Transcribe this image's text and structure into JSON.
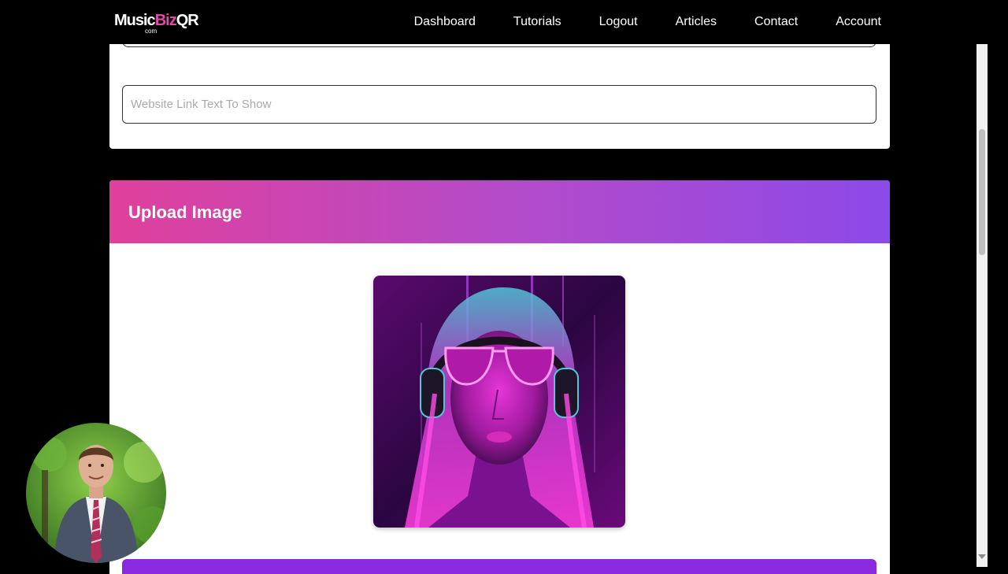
{
  "brand": {
    "name_part1": "Music",
    "name_part2": "Biz",
    "name_part3": "QR",
    "sub": "com",
    "accent": "#e24aa6"
  },
  "nav": {
    "items": [
      {
        "label": "Dashboard"
      },
      {
        "label": "Tutorials"
      },
      {
        "label": "Logout"
      },
      {
        "label": "Articles"
      },
      {
        "label": "Contact"
      },
      {
        "label": "Account"
      }
    ]
  },
  "link_card": {
    "website_link_text": {
      "value": "",
      "placeholder": "Website Link Text To Show"
    }
  },
  "upload_card": {
    "title": "Upload Image",
    "header_gradient": [
      "#e0409c",
      "#8c4ae8"
    ],
    "image_icon": "neon-portrait-image",
    "button_color": "#8a2be2"
  },
  "presenter": {
    "icon": "presenter-webcam"
  }
}
